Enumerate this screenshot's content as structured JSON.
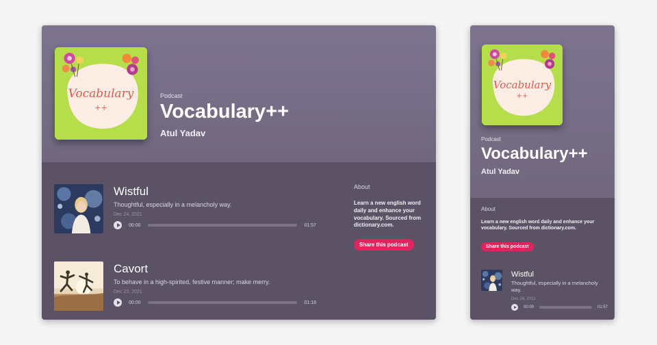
{
  "podcast": {
    "kicker": "Podcast",
    "title": "Vocabulary++",
    "author": "Atul Yadav",
    "cover": {
      "title": "Vocabulary",
      "subtitle": "++",
      "colors": {
        "background": "#b5de4a",
        "blob": "#fbece4",
        "text": "#e05a4e"
      }
    }
  },
  "about": {
    "label": "About",
    "text": "Learn a new english word daily and enhance your vocabulary. Sourced from dictionary.com.",
    "share_label": "Share this podcast"
  },
  "episodes": [
    {
      "title": "Wistful",
      "description": "Thoughtful, especially in a melancholy way.",
      "date": "Dec 24, 2021",
      "current_time": "00:00",
      "duration": "01:57",
      "progress": 0
    },
    {
      "title": "Cavort",
      "description": "To behave in a high-spirited, festive manner; make merry.",
      "date": "Dec 23, 2021",
      "current_time": "00:00",
      "duration": "01:18",
      "progress": 0
    }
  ],
  "colors": {
    "hero": "#786e89",
    "body": "#5b5266",
    "accent": "#e0245e"
  }
}
